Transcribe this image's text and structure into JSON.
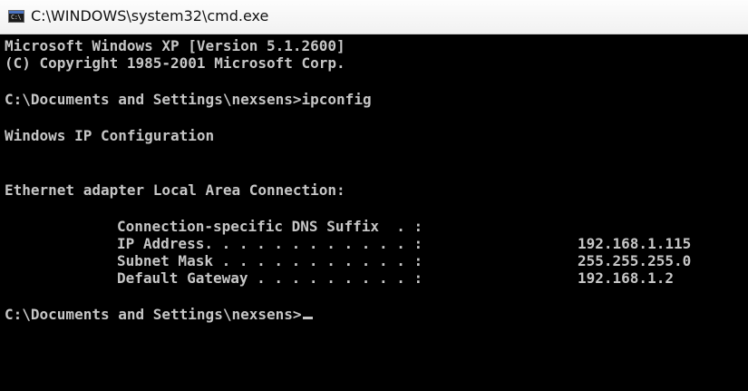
{
  "window": {
    "title": "C:\\WINDOWS\\system32\\cmd.exe",
    "icon_name": "cmd-icon",
    "icon_glyph": "C:\\"
  },
  "console": {
    "lines": [
      "Microsoft Windows XP [Version 5.1.2600]",
      "(C) Copyright 1985-2001 Microsoft Corp.",
      "C:\\Documents and Settings\\nexsens>ipconfig",
      "Windows IP Configuration",
      "Ethernet adapter Local Area Connection:"
    ],
    "entries": [
      {
        "label": "Connection-specific DNS Suffix  . :",
        "value": ""
      },
      {
        "label": "IP Address. . . . . . . . . . . . :",
        "value": "192.168.1.115"
      },
      {
        "label": "Subnet Mask . . . . . . . . . . . :",
        "value": "255.255.255.0"
      },
      {
        "label": "Default Gateway . . . . . . . . . :",
        "value": "192.168.1.2"
      }
    ],
    "prompt": "C:\\Documents and Settings\\nexsens>"
  },
  "colors": {
    "background": "#000000",
    "text": "#c6c6c6",
    "titlebar": "#f4f4f4"
  }
}
